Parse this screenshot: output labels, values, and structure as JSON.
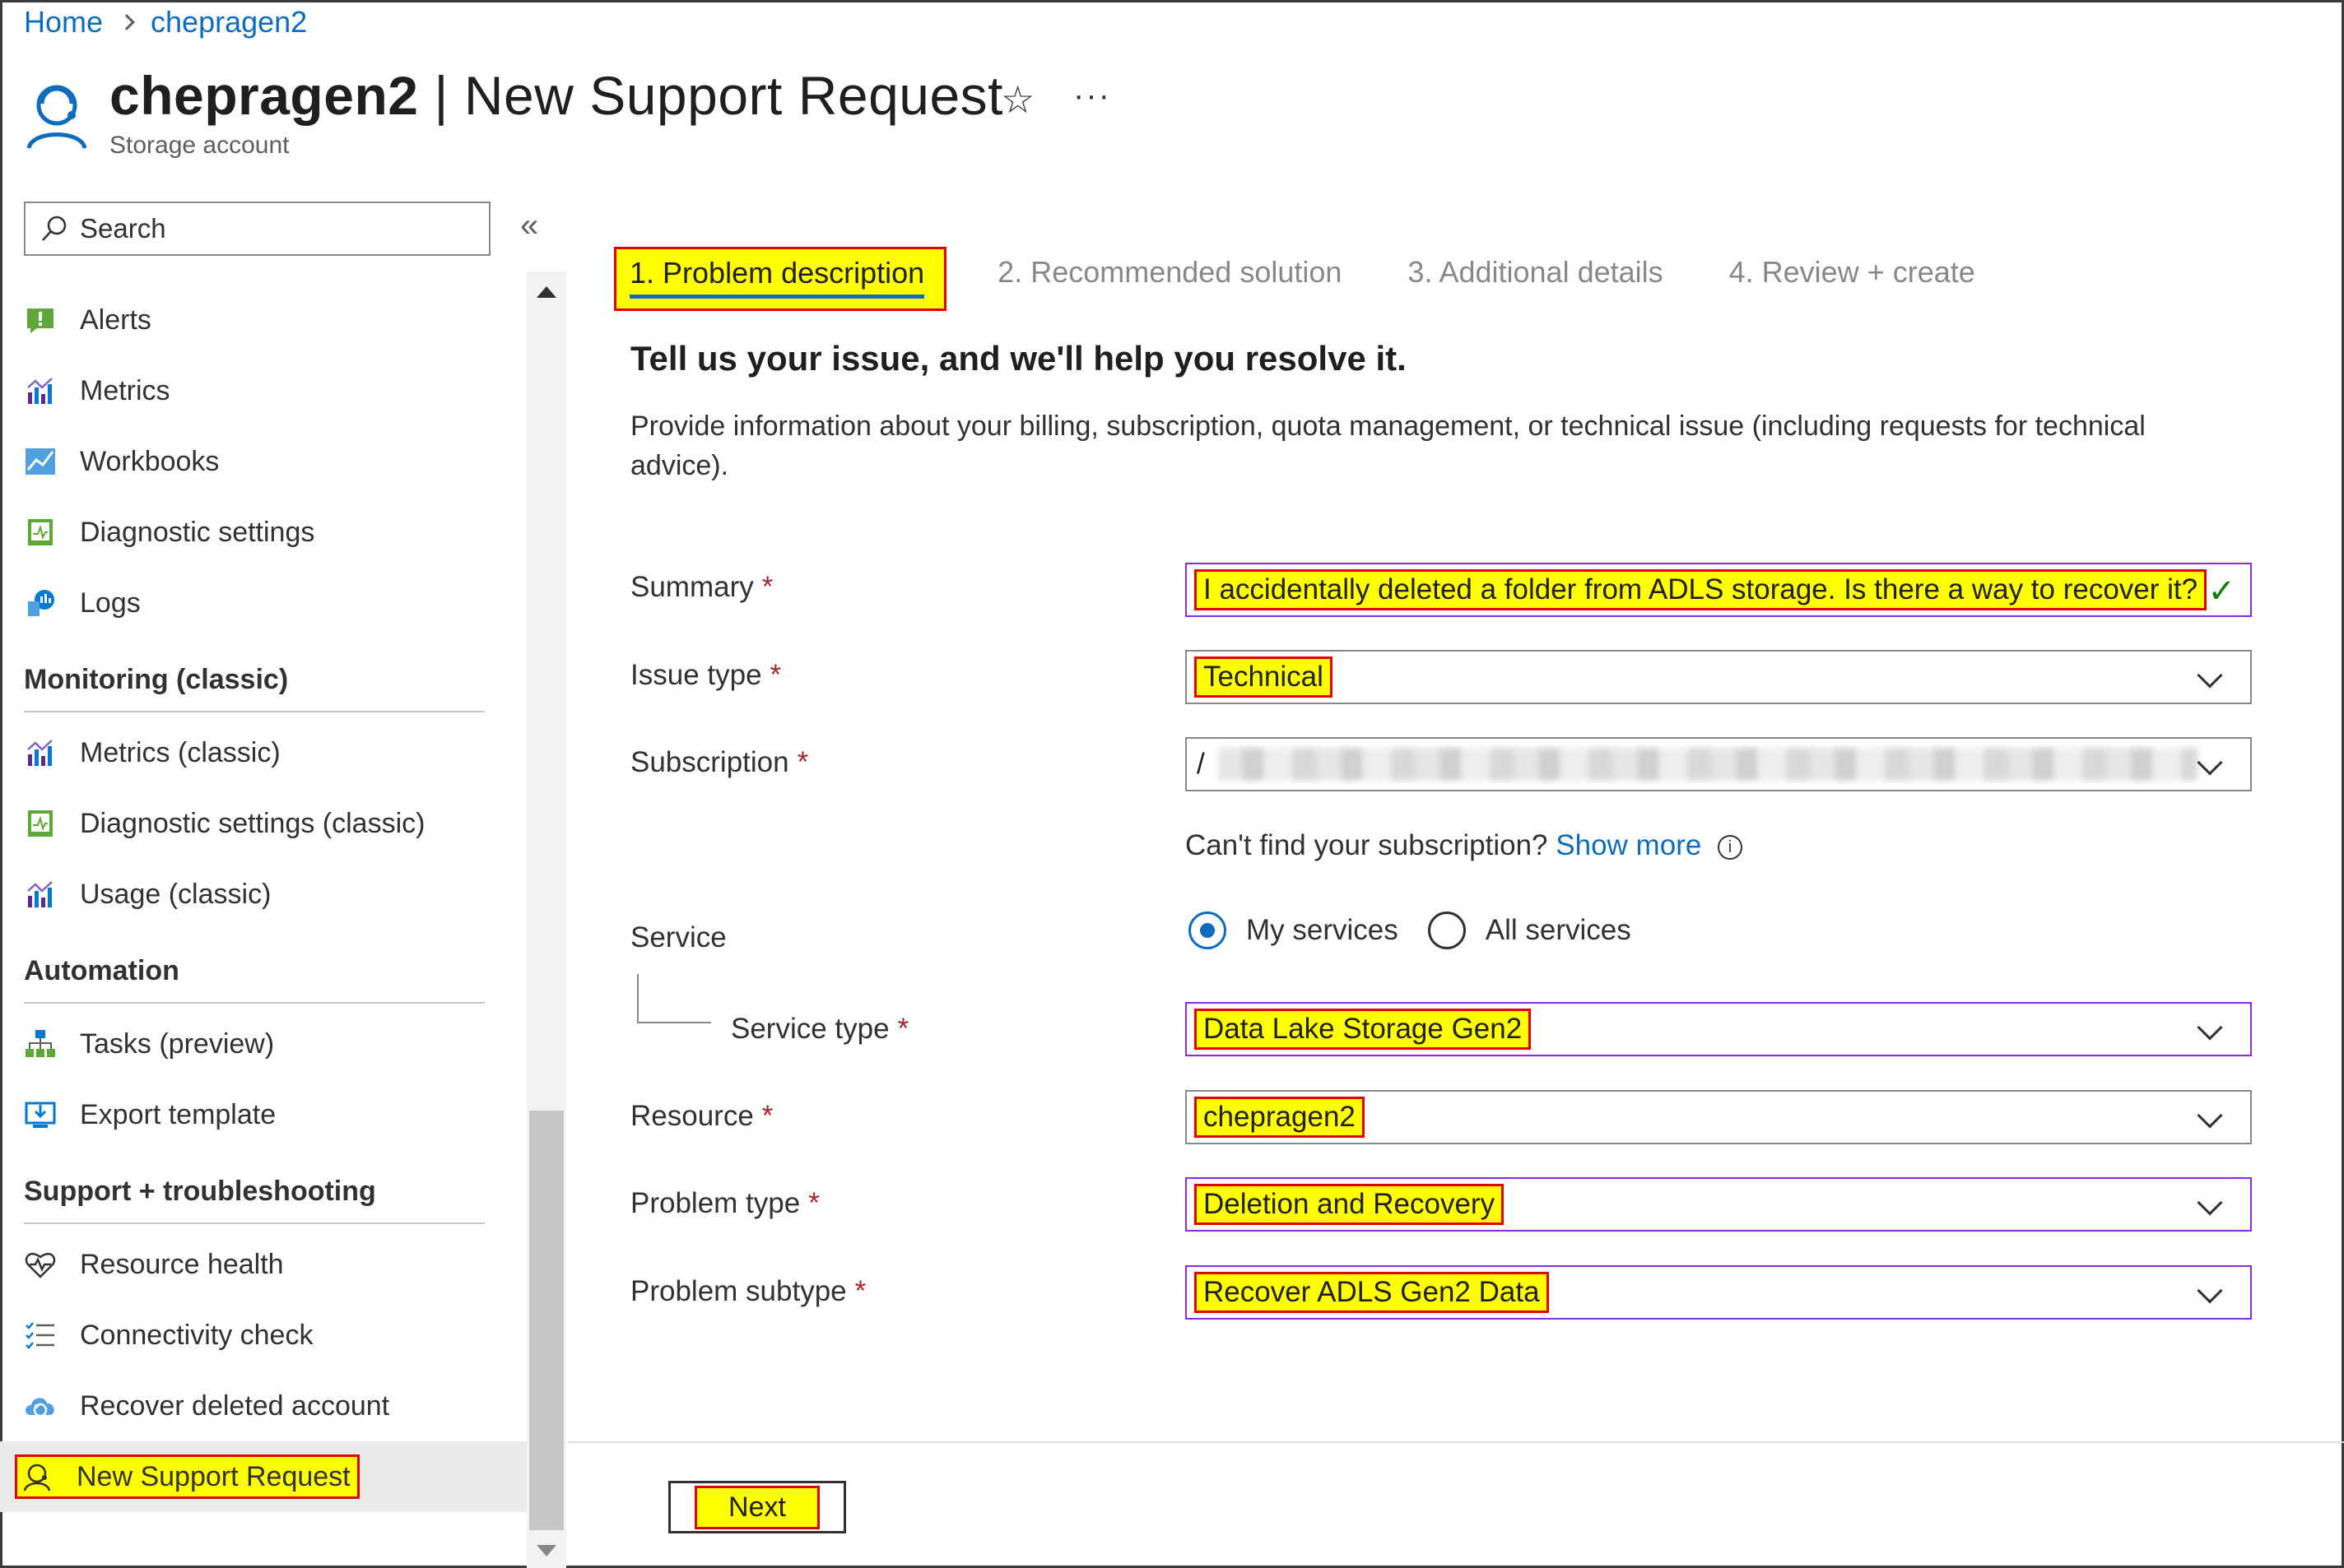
{
  "breadcrumb": {
    "home": "Home",
    "current": "chepragen2"
  },
  "header": {
    "resource_name": "chepragen2",
    "separator": "|",
    "page_title": "New Support Request",
    "subtitle": "Storage account",
    "favorite_icon": "star-icon",
    "more_label": "···"
  },
  "sidebar": {
    "search_placeholder": "Search",
    "collapse_label": "«",
    "top_items": [
      {
        "label": "Alerts",
        "icon": "alerts-icon"
      },
      {
        "label": "Metrics",
        "icon": "metrics-icon"
      },
      {
        "label": "Workbooks",
        "icon": "workbooks-icon"
      },
      {
        "label": "Diagnostic settings",
        "icon": "diagnostic-settings-icon"
      },
      {
        "label": "Logs",
        "icon": "logs-icon"
      }
    ],
    "monitoring_classic": {
      "title": "Monitoring (classic)",
      "items": [
        {
          "label": "Metrics (classic)",
          "icon": "metrics-icon"
        },
        {
          "label": "Diagnostic settings (classic)",
          "icon": "diagnostic-settings-icon"
        },
        {
          "label": "Usage (classic)",
          "icon": "usage-icon"
        }
      ]
    },
    "automation": {
      "title": "Automation",
      "items": [
        {
          "label": "Tasks (preview)",
          "icon": "tasks-icon"
        },
        {
          "label": "Export template",
          "icon": "export-template-icon"
        }
      ]
    },
    "support": {
      "title": "Support + troubleshooting",
      "items": [
        {
          "label": "Resource health",
          "icon": "heart-icon"
        },
        {
          "label": "Connectivity check",
          "icon": "checklist-icon"
        },
        {
          "label": "Recover deleted account",
          "icon": "cloud-recover-icon"
        },
        {
          "label": "New Support Request",
          "icon": "support-person-icon"
        }
      ]
    }
  },
  "tabs": [
    {
      "label": "1. Problem description",
      "active": true
    },
    {
      "label": "2. Recommended solution",
      "active": false
    },
    {
      "label": "3. Additional details",
      "active": false
    },
    {
      "label": "4. Review + create",
      "active": false
    }
  ],
  "main": {
    "heading": "Tell us your issue, and we'll help you resolve it.",
    "description": "Provide information about your billing, subscription, quota management, or technical issue (including requests for technical advice)."
  },
  "form": {
    "required_marker": "*",
    "summary": {
      "label": "Summary",
      "value": "I accidentally deleted a folder from ADLS storage. Is there a way to recover it?"
    },
    "issue_type": {
      "label": "Issue type",
      "value": "Technical"
    },
    "subscription": {
      "label": "Subscription",
      "value": "/"
    },
    "cant_find": {
      "text": "Can't find your subscription?",
      "link": "Show more",
      "info": "i"
    },
    "service": {
      "label": "Service",
      "options": [
        "My services",
        "All services"
      ],
      "selected": "My services"
    },
    "service_type": {
      "label": "Service type",
      "value": "Data Lake Storage Gen2"
    },
    "resource": {
      "label": "Resource",
      "value": "chepragen2"
    },
    "problem_type": {
      "label": "Problem type",
      "value": "Deletion and Recovery"
    },
    "problem_subtype": {
      "label": "Problem subtype",
      "value": "Recover ADLS Gen2 Data"
    }
  },
  "footer": {
    "next_label": "Next"
  },
  "colors": {
    "accent": "#0f6cbd",
    "highlight": "#ffff00",
    "highlight_border": "#e00000",
    "required": "#a4262c",
    "valid": "#107c10"
  }
}
